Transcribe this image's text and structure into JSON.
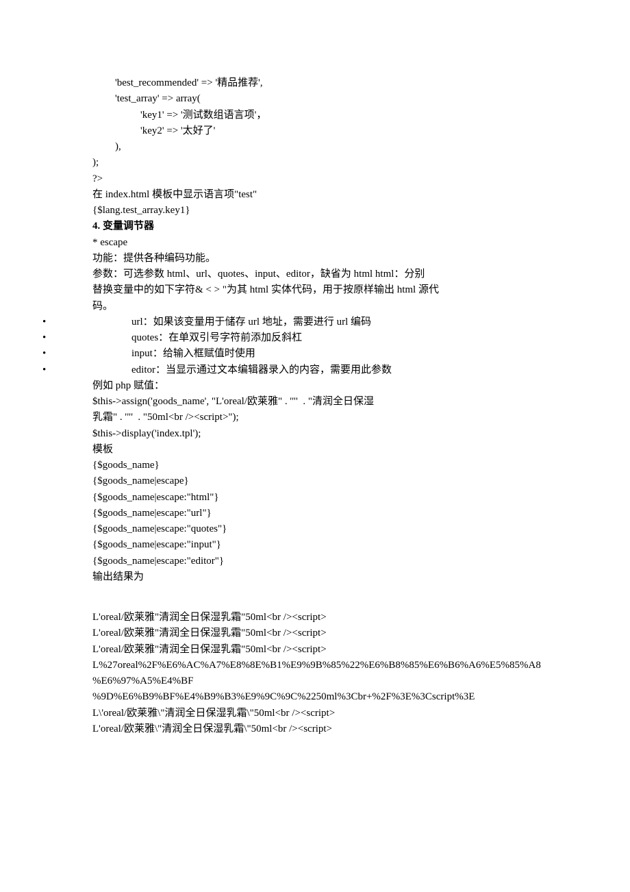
{
  "code_top": {
    "l1": "'best_recommended' => '精品推荐',",
    "l2": "'test_array' => array(",
    "l3": "'key1' => '测试数组语言项'，",
    "l4": "'key2' => '太好了'",
    "l5": "),",
    "l6": ");",
    "l7": "?>"
  },
  "tpl_note": {
    "l1": "在 index.html 模板中显示语言项\"test\"",
    "l2": "{$lang.test_array.key1}"
  },
  "section4": {
    "heading": "4. 变量调节器",
    "escape_label": "* escape",
    "func_line": "功能：提供各种编码功能。",
    "param_l1": "参数：可选参数 html、url、quotes、input、editor，缺省为 html html：分别",
    "param_l2": "替换变量中的如下字符& < > \"为其 html 实体代码，用于按原样输出 html 源代",
    "param_l3": "码。"
  },
  "bullets": {
    "b1": "url：如果该变量用于储存 url 地址，需要进行 url 编码",
    "b2": "quotes：在单双引号字符前添加反斜杠",
    "b3": "input：给输入框赋值时使用",
    "b4": "editor：当显示通过文本编辑器录入的内容，需要用此参数"
  },
  "example": {
    "title": "例如 php 赋值：",
    "l1": "$this->assign('goods_name', \"L'oreal/欧莱雅\" . '\"'  . \"清润全日保湿",
    "l2": "乳霜\" . '\"'  . \"50ml<br /><script>\");",
    "l3": "$this->display('index.tpl');"
  },
  "tpl_block": {
    "title": "模板",
    "l1": "{$goods_name}",
    "l2": "{$goods_name|escape}",
    "l3": "{$goods_name|escape:\"html\"}",
    "l4": "{$goods_name|escape:\"url\"}",
    "l5": "{$goods_name|escape:\"quotes\"}",
    "l6": "{$goods_name|escape:\"input\"}",
    "l7": "{$goods_name|escape:\"editor\"}"
  },
  "output_block": {
    "title": "输出结果为",
    "l1": "L'oreal/欧莱雅\"清润全日保湿乳霜\"50ml<br /><script>",
    "l2": "L'oreal/欧莱雅\"清润全日保湿乳霜\"50ml<br /><script>",
    "l3": "L'oreal/欧莱雅\"清润全日保湿乳霜\"50ml<br /><script>",
    "l4": "L%27oreal%2F%E6%AC%A7%E8%8E%B1%E9%9B%85%22%E6%B8%85%E6%B6%A6%E5%85%A8",
    "l5": "%E6%97%A5%E4%BF",
    "l6": "%9D%E6%B9%BF%E4%B9%B3%E9%9C%9C%2250ml%3Cbr+%2F%3E%3Cscript%3E",
    "l7": "L\\'oreal/欧莱雅\\\"清润全日保湿乳霜\\\"50ml<br /><script>",
    "l8": "L'oreal/欧莱雅\\\"清润全日保湿乳霜\\\"50ml<br /><script>"
  }
}
